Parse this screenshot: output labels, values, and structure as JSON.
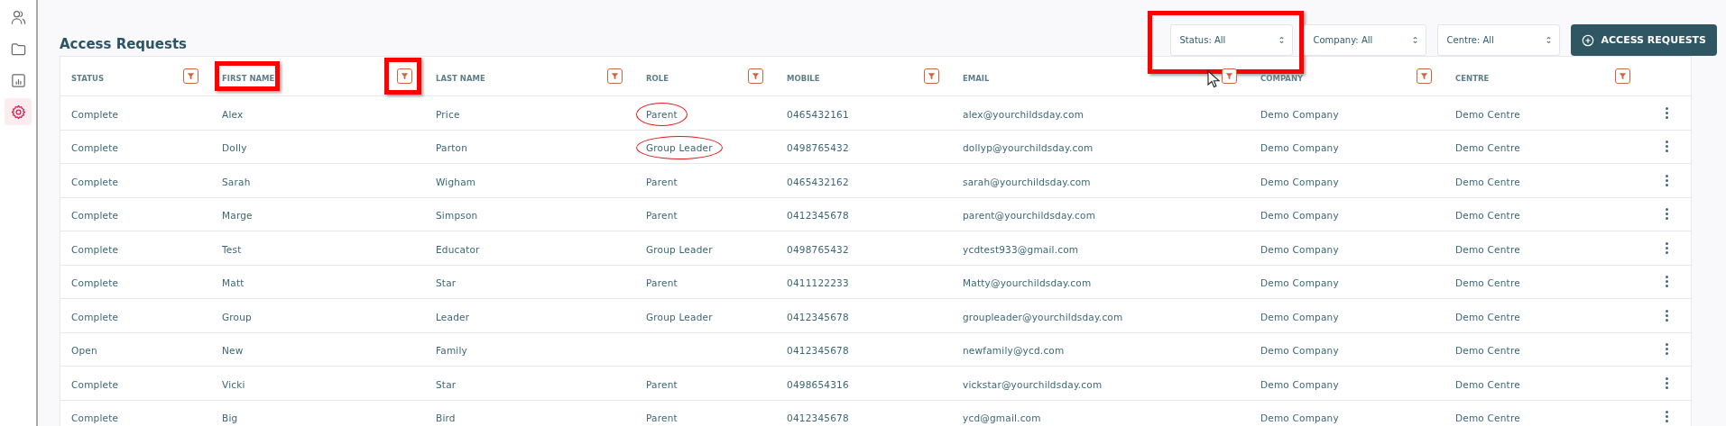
{
  "sidebar": {
    "items": [
      {
        "kind": "users",
        "selected": false
      },
      {
        "kind": "folder",
        "selected": false
      },
      {
        "kind": "report",
        "selected": false
      },
      {
        "kind": "settings",
        "selected": true
      }
    ]
  },
  "page_title": "Access Requests",
  "filters": [
    {
      "label": "Status: All",
      "marked": true
    },
    {
      "label": "Company:  All",
      "marked": false
    },
    {
      "label": "Centre:  All",
      "marked": false
    }
  ],
  "add_button": "ACCESS REQUESTS",
  "table": {
    "columns": [
      {
        "label": "STATUS",
        "label_marked": false,
        "filter_marked": false
      },
      {
        "label": "FIRST NAME",
        "label_marked": true,
        "filter_marked": true
      },
      {
        "label": "LAST NAME",
        "label_marked": false,
        "filter_marked": false
      },
      {
        "label": "ROLE",
        "label_marked": false,
        "filter_marked": false
      },
      {
        "label": "MOBILE",
        "label_marked": false,
        "filter_marked": false
      },
      {
        "label": "EMAIL",
        "label_marked": false,
        "filter_marked": false
      },
      {
        "label": "COMPANY",
        "label_marked": false,
        "filter_marked": false
      },
      {
        "label": "CENTRE",
        "label_marked": false,
        "filter_marked": false
      }
    ],
    "rows": [
      {
        "status": "Complete",
        "first_name": "Alex",
        "last_name": "Price",
        "role": "Parent",
        "role_marked": true,
        "mobile": "0465432161",
        "email": "alex@yourchildsday.com",
        "company": "Demo Company",
        "centre": "Demo Centre"
      },
      {
        "status": "Complete",
        "first_name": "Dolly",
        "last_name": "Parton",
        "role": "Group Leader",
        "role_marked": true,
        "mobile": "0498765432",
        "email": "dollyp@yourchildsday.com",
        "company": "Demo Company",
        "centre": "Demo Centre"
      },
      {
        "status": "Complete",
        "first_name": "Sarah",
        "last_name": "Wigham",
        "role": "Parent",
        "role_marked": false,
        "mobile": "0465432162",
        "email": "sarah@yourchildsday.com",
        "company": "Demo Company",
        "centre": "Demo Centre"
      },
      {
        "status": "Complete",
        "first_name": "Marge",
        "last_name": "Simpson",
        "role": "Parent",
        "role_marked": false,
        "mobile": "0412345678",
        "email": "parent@yourchildsday.com",
        "company": "Demo Company",
        "centre": "Demo Centre"
      },
      {
        "status": "Complete",
        "first_name": "Test",
        "last_name": "Educator",
        "role": "Group Leader",
        "role_marked": false,
        "mobile": "0498765432",
        "email": "ycdtest933@gmail.com",
        "company": "Demo Company",
        "centre": "Demo Centre"
      },
      {
        "status": "Complete",
        "first_name": "Matt",
        "last_name": "Star",
        "role": "Parent",
        "role_marked": false,
        "mobile": "0411122233",
        "email": "Matty@yourchildsday.com",
        "company": "Demo Company",
        "centre": "Demo Centre"
      },
      {
        "status": "Complete",
        "first_name": "Group",
        "last_name": "Leader",
        "role": "Group Leader",
        "role_marked": false,
        "mobile": "0412345678",
        "email": "groupleader@yourchildsday.com",
        "company": "Demo Company",
        "centre": "Demo Centre"
      },
      {
        "status": "Open",
        "first_name": "New",
        "last_name": "Family",
        "mobile": "0412345678",
        "email": "newfamily@ycd.com",
        "company": "Demo Company",
        "centre": "Demo Centre"
      },
      {
        "status": "Complete",
        "first_name": "Vicki",
        "last_name": "Star",
        "role": "Parent",
        "role_marked": false,
        "mobile": "0498654316",
        "email": "vickstar@yourchildsday.com",
        "company": "Demo Company",
        "centre": "Demo Centre"
      },
      {
        "status": "Complete",
        "first_name": "Big",
        "last_name": "Bird",
        "role": "Parent",
        "role_marked": false,
        "mobile": "0412345678",
        "email": "ycd@gmail.com",
        "company": "Demo Company",
        "centre": "Demo Centre"
      }
    ]
  }
}
